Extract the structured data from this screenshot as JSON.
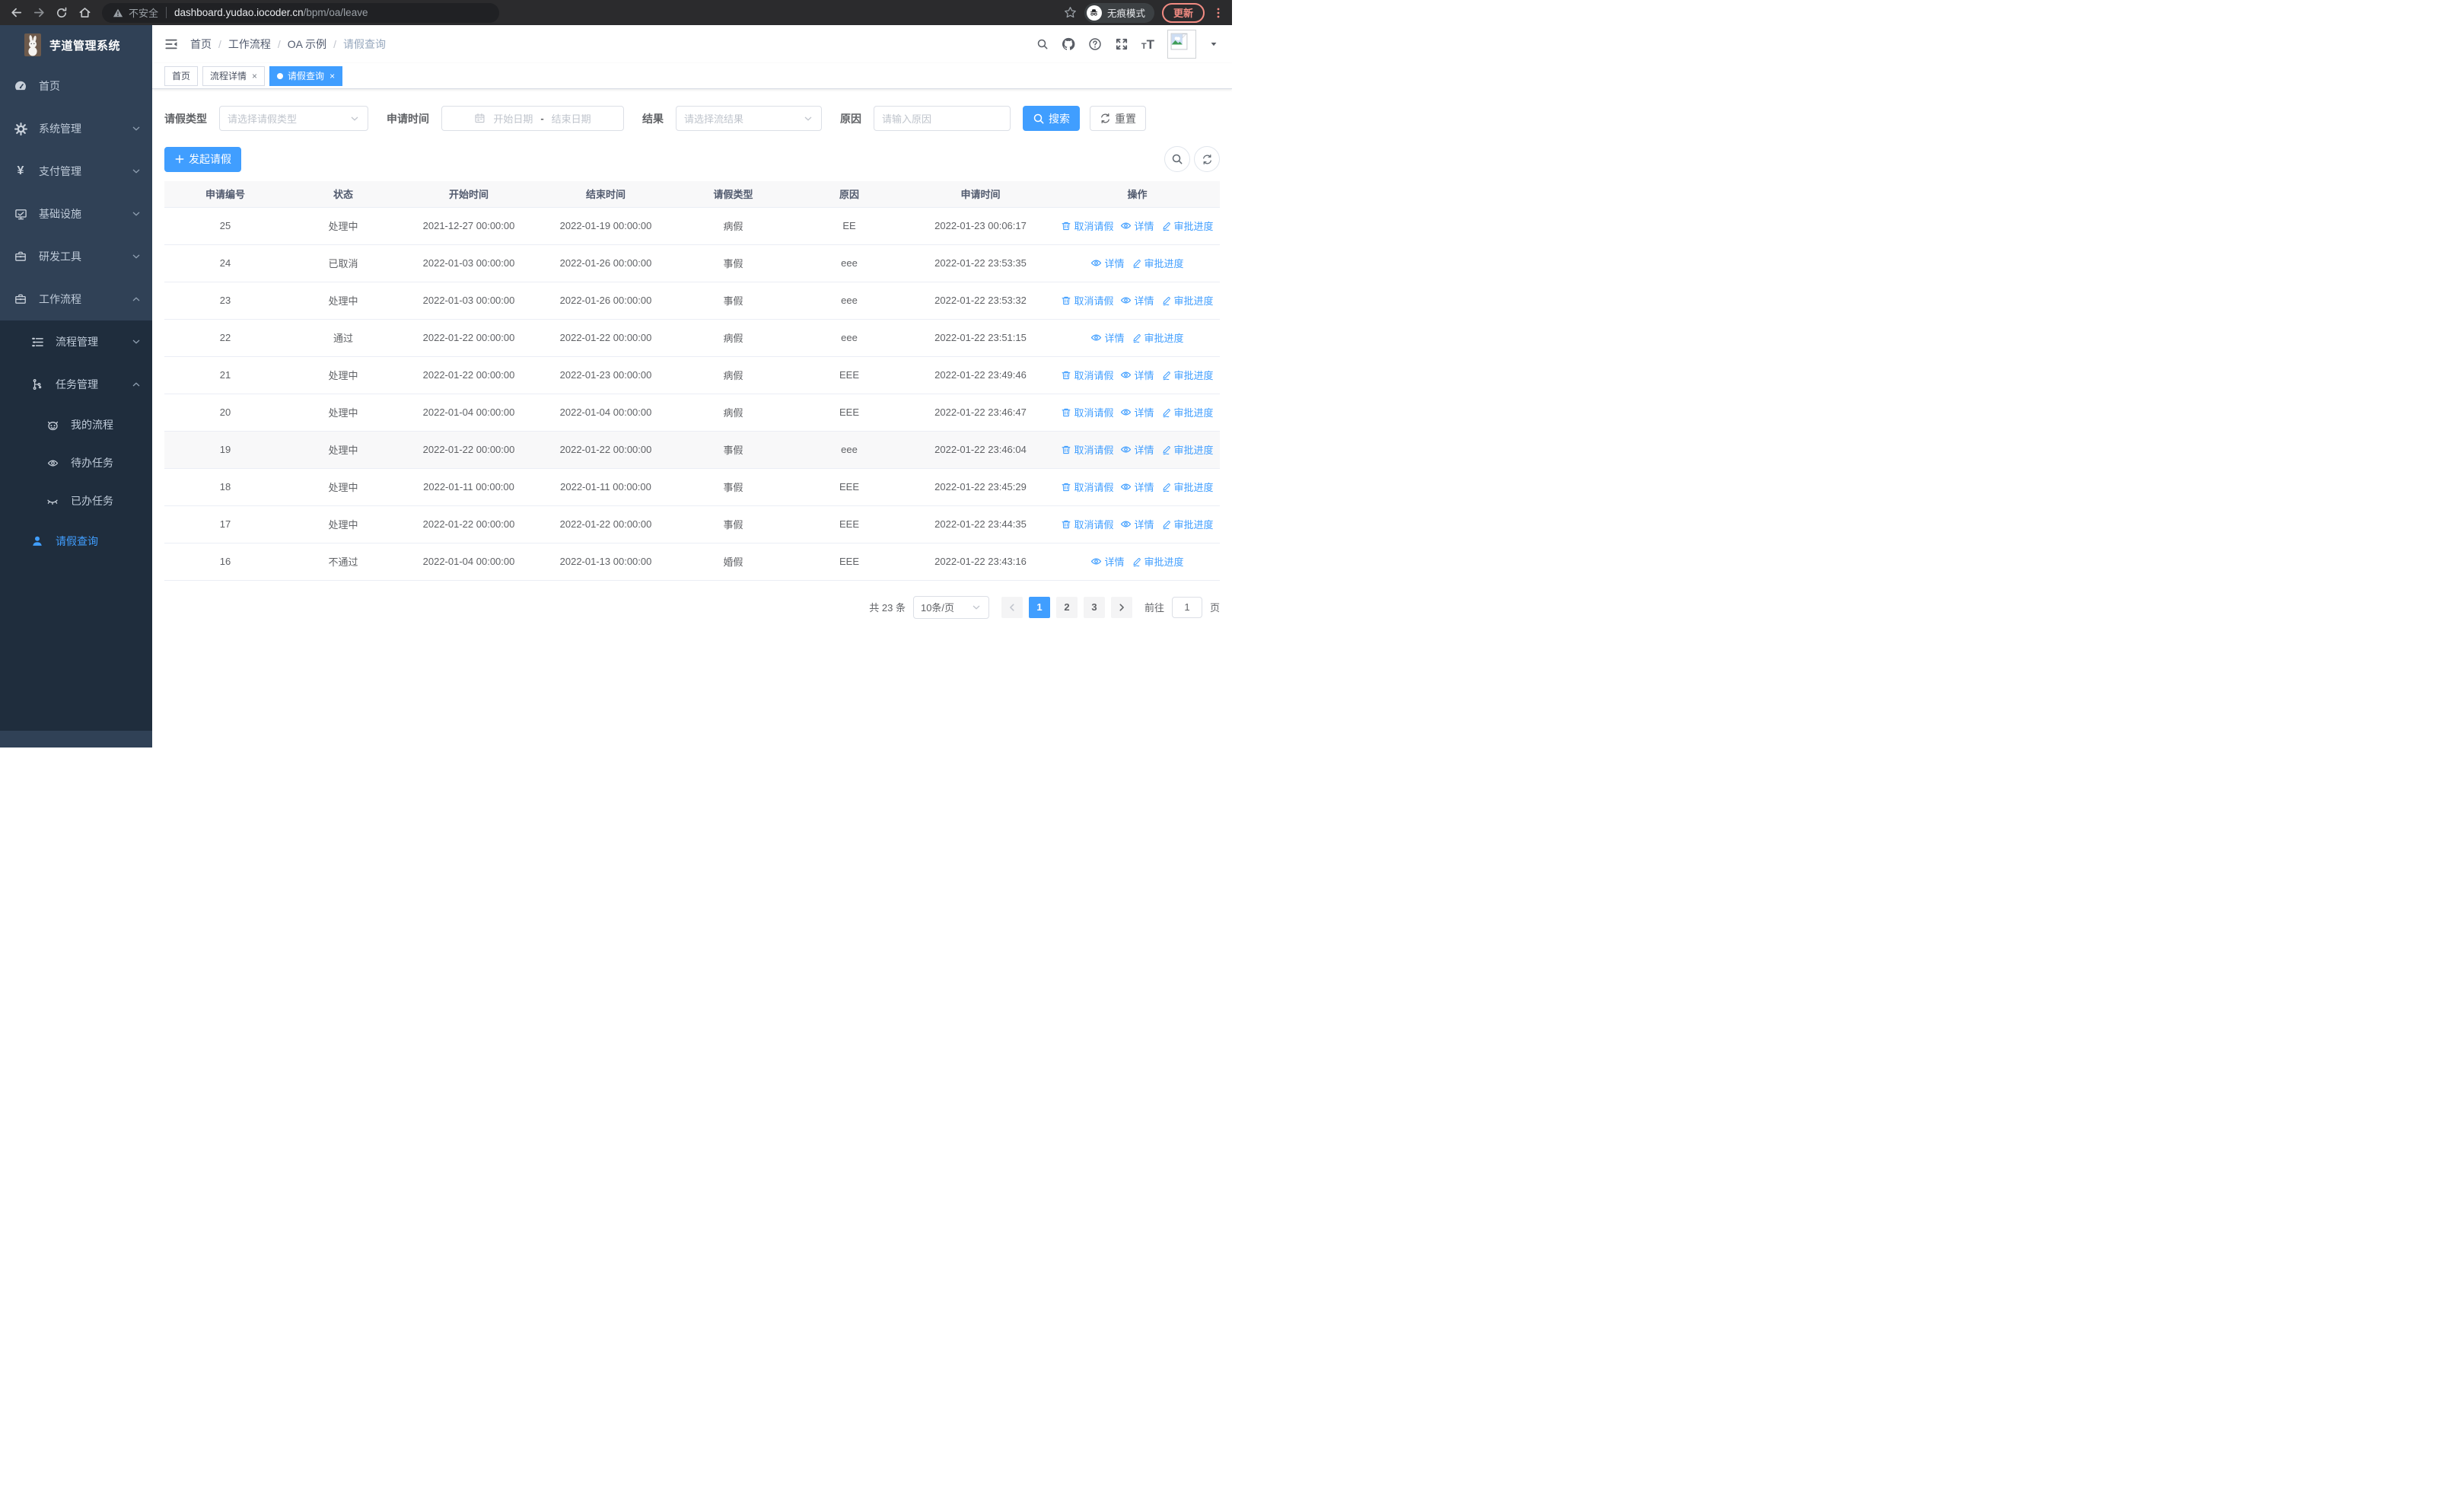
{
  "browser": {
    "security_text": "不安全",
    "url_host": "dashboard.yudao.iocoder.cn",
    "url_path": "/bpm/oa/leave",
    "incognito_label": "无痕模式",
    "update_label": "更新"
  },
  "glyphs": {
    "close": "×",
    "breadcrumb_separator": "/"
  },
  "icons": {
    "back-icon": "←",
    "forward-icon": "→",
    "reload-icon": "⟳",
    "home-icon": "⌂",
    "warning-icon": "▲",
    "star-icon": "☆",
    "incognito-icon": "🕶",
    "menu-dots-icon": "⋮",
    "fold-icon": "☰",
    "search-icon": "🔍",
    "github-icon": "github",
    "question-icon": "?",
    "fullscreen-icon": "⛶",
    "font-size-icon": "T",
    "caret-down-icon": "▾",
    "calendar-icon": "📅",
    "refresh-icon": "⟲",
    "plus-icon": "+",
    "trash-icon": "🗑",
    "eye-icon": "👁",
    "pen-icon": "✎"
  },
  "sidebar": {
    "logo_title": "芋道管理系统",
    "menu": [
      {
        "key": "home",
        "icon": "dashboard",
        "label": "首页",
        "arrow": ""
      },
      {
        "key": "system",
        "icon": "gear",
        "label": "系统管理",
        "arrow": "down"
      },
      {
        "key": "payment",
        "icon": "yen",
        "label": "支付管理",
        "arrow": "down"
      },
      {
        "key": "infra",
        "icon": "monitor",
        "label": "基础设施",
        "arrow": "down"
      },
      {
        "key": "devtools",
        "icon": "briefcase",
        "label": "研发工具",
        "arrow": "down"
      },
      {
        "key": "workflow",
        "icon": "briefcase",
        "label": "工作流程",
        "arrow": "up"
      }
    ],
    "submenu": [
      {
        "key": "process-mgmt",
        "icon": "listicon",
        "label": "流程管理",
        "arrow": "down",
        "level": 1,
        "active": false
      },
      {
        "key": "task-mgmt",
        "icon": "flow",
        "label": "任务管理",
        "arrow": "up",
        "level": 1,
        "active": false
      },
      {
        "key": "my-process",
        "icon": "robot",
        "label": "我的流程",
        "arrow": "",
        "level": 2,
        "active": false
      },
      {
        "key": "todo-tasks",
        "icon": "eye",
        "label": "待办任务",
        "arrow": "",
        "level": 2,
        "active": false
      },
      {
        "key": "done-tasks",
        "icon": "eyeclosed",
        "label": "已办任务",
        "arrow": "",
        "level": 2,
        "active": false
      },
      {
        "key": "leave-query",
        "icon": "userfill",
        "label": "请假查询",
        "arrow": "",
        "level": 1,
        "active": true
      }
    ]
  },
  "header": {
    "breadcrumb": [
      "首页",
      "工作流程",
      "OA 示例",
      "请假查询"
    ]
  },
  "tabs": [
    {
      "key": "home",
      "label": "首页",
      "closable": false,
      "active": false
    },
    {
      "key": "process-detail",
      "label": "流程详情",
      "closable": true,
      "active": false
    },
    {
      "key": "leave-query",
      "label": "请假查询",
      "closable": true,
      "active": true
    }
  ],
  "filters": {
    "leave_type_label": "请假类型",
    "leave_type_placeholder": "请选择请假类型",
    "apply_time_label": "申请时间",
    "start_date_placeholder": "开始日期",
    "date_separator": "-",
    "end_date_placeholder": "结束日期",
    "result_label": "结果",
    "result_placeholder": "请选择流结果",
    "reason_label": "原因",
    "reason_placeholder": "请输入原因",
    "search_label": "搜索",
    "reset_label": "重置"
  },
  "toolbar": {
    "create_label": "发起请假"
  },
  "table": {
    "headers": [
      "申请编号",
      "状态",
      "开始时间",
      "结束时间",
      "请假类型",
      "原因",
      "申请时间",
      "操作"
    ],
    "action_labels": {
      "cancel": "取消请假",
      "detail": "详情",
      "progress": "审批进度"
    },
    "rows": [
      {
        "id": "25",
        "status": "处理中",
        "start": "2021-12-27 00:00:00",
        "end": "2022-01-19 00:00:00",
        "type": "病假",
        "reason": "EE",
        "apply_time": "2022-01-23 00:06:17",
        "actions": [
          "cancel",
          "detail",
          "progress"
        ],
        "highlight": false
      },
      {
        "id": "24",
        "status": "已取消",
        "start": "2022-01-03 00:00:00",
        "end": "2022-01-26 00:00:00",
        "type": "事假",
        "reason": "eee",
        "apply_time": "2022-01-22 23:53:35",
        "actions": [
          "detail",
          "progress"
        ],
        "highlight": false
      },
      {
        "id": "23",
        "status": "处理中",
        "start": "2022-01-03 00:00:00",
        "end": "2022-01-26 00:00:00",
        "type": "事假",
        "reason": "eee",
        "apply_time": "2022-01-22 23:53:32",
        "actions": [
          "cancel",
          "detail",
          "progress"
        ],
        "highlight": false
      },
      {
        "id": "22",
        "status": "通过",
        "start": "2022-01-22 00:00:00",
        "end": "2022-01-22 00:00:00",
        "type": "病假",
        "reason": "eee",
        "apply_time": "2022-01-22 23:51:15",
        "actions": [
          "detail",
          "progress"
        ],
        "highlight": false
      },
      {
        "id": "21",
        "status": "处理中",
        "start": "2022-01-22 00:00:00",
        "end": "2022-01-23 00:00:00",
        "type": "病假",
        "reason": "EEE",
        "apply_time": "2022-01-22 23:49:46",
        "actions": [
          "cancel",
          "detail",
          "progress"
        ],
        "highlight": false
      },
      {
        "id": "20",
        "status": "处理中",
        "start": "2022-01-04 00:00:00",
        "end": "2022-01-04 00:00:00",
        "type": "病假",
        "reason": "EEE",
        "apply_time": "2022-01-22 23:46:47",
        "actions": [
          "cancel",
          "detail",
          "progress"
        ],
        "highlight": false
      },
      {
        "id": "19",
        "status": "处理中",
        "start": "2022-01-22 00:00:00",
        "end": "2022-01-22 00:00:00",
        "type": "事假",
        "reason": "eee",
        "apply_time": "2022-01-22 23:46:04",
        "actions": [
          "cancel",
          "detail",
          "progress"
        ],
        "highlight": true
      },
      {
        "id": "18",
        "status": "处理中",
        "start": "2022-01-11 00:00:00",
        "end": "2022-01-11 00:00:00",
        "type": "事假",
        "reason": "EEE",
        "apply_time": "2022-01-22 23:45:29",
        "actions": [
          "cancel",
          "detail",
          "progress"
        ],
        "highlight": false
      },
      {
        "id": "17",
        "status": "处理中",
        "start": "2022-01-22 00:00:00",
        "end": "2022-01-22 00:00:00",
        "type": "事假",
        "reason": "EEE",
        "apply_time": "2022-01-22 23:44:35",
        "actions": [
          "cancel",
          "detail",
          "progress"
        ],
        "highlight": false
      },
      {
        "id": "16",
        "status": "不通过",
        "start": "2022-01-04 00:00:00",
        "end": "2022-01-13 00:00:00",
        "type": "婚假",
        "reason": "EEE",
        "apply_time": "2022-01-22 23:43:16",
        "actions": [
          "detail",
          "progress"
        ],
        "highlight": false
      }
    ]
  },
  "pagination": {
    "total_label": "共 23 条",
    "page_size_label": "10条/页",
    "pages": [
      "1",
      "2",
      "3"
    ],
    "active_page": "1",
    "goto_label": "前往",
    "goto_value": "1",
    "goto_unit": "页"
  },
  "colors": {
    "primary": "#409eff",
    "sidebar_bg": "#304156",
    "submenu_bg": "#1f2d3d",
    "sidebar_text": "#bfcbd9",
    "update_accent": "#f28b82",
    "browser_bar": "#2b2b2d"
  }
}
